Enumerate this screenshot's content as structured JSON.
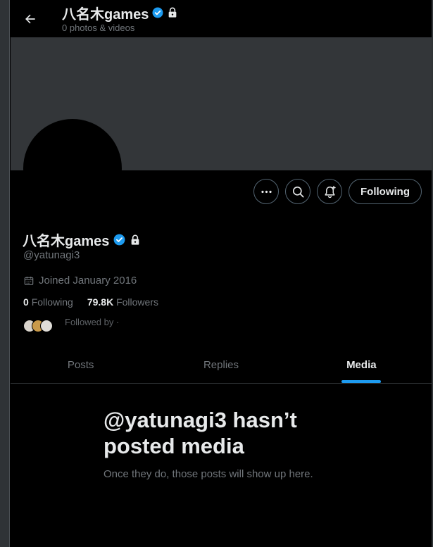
{
  "header": {
    "display_name": "八名木games",
    "subtitle": "0 photos & videos"
  },
  "profile": {
    "display_name": "八名木games",
    "handle": "@yatunagi3",
    "joined": "Joined January 2016",
    "following_count": "0",
    "following_label": "Following",
    "followers_count": "79.8K",
    "followers_label": "Followers",
    "followed_by_text": "Followed by ·"
  },
  "actions": {
    "more_icon": "more-dots-icon",
    "search_icon": "search-icon",
    "notify_icon": "bell-plus-icon",
    "following_button": "Following"
  },
  "tabs": [
    {
      "label": "Posts"
    },
    {
      "label": "Replies"
    },
    {
      "label": "Media"
    }
  ],
  "empty_state": {
    "title": "@yatunagi3 hasn’t posted media",
    "subtitle": "Once they do, those posts will show up here."
  },
  "colors": {
    "background": "#000000",
    "banner": "#333639",
    "accent": "#1d9bf0",
    "muted_text": "#71767b",
    "primary_text": "#e7e9ea"
  }
}
